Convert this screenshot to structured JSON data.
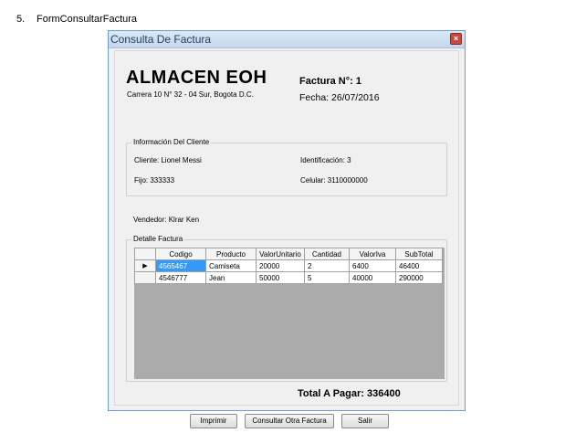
{
  "document": {
    "heading_number": "5.",
    "heading_text": "FormConsultarFactura"
  },
  "window": {
    "title": "Consulta De Factura",
    "close_glyph": "×"
  },
  "store": {
    "name": "ALMACEN EOH",
    "address": "Carrera 10 N° 32 - 04 Sur, Bogota D.C."
  },
  "invoice": {
    "number_label": "Factura N°: 1",
    "date_label": "Fecha: 26/07/2016"
  },
  "client_group": {
    "legend": "Información Del Cliente",
    "cliente": "Cliente: Lionel Messi",
    "identificacion": "Identificación: 3",
    "fijo": "Fijo: 333333",
    "celular": "Celular: 3110000000"
  },
  "vendedor": "Vendedor: Klrar Ken",
  "detail_group": {
    "legend": "Detalle Factura",
    "columns": [
      "Codigo",
      "Producto",
      "ValorUnitario",
      "Cantidad",
      "ValorIva",
      "SubTotal"
    ],
    "current_row_marker": "▶",
    "rows": [
      [
        "4565467",
        "Camiseta",
        "20000",
        "2",
        "6400",
        "46400"
      ],
      [
        "4546777",
        "Jean",
        "50000",
        "5",
        "40000",
        "290000"
      ]
    ]
  },
  "total_label": "Total A Pagar: 336400",
  "buttons": {
    "imprimir": "Imprimir",
    "consultar": "Consultar Otra Factura",
    "salir": "Salir"
  },
  "colors": {
    "selection": "#3399ff",
    "grid_background": "#ababab",
    "close_button": "#c84a3c"
  }
}
